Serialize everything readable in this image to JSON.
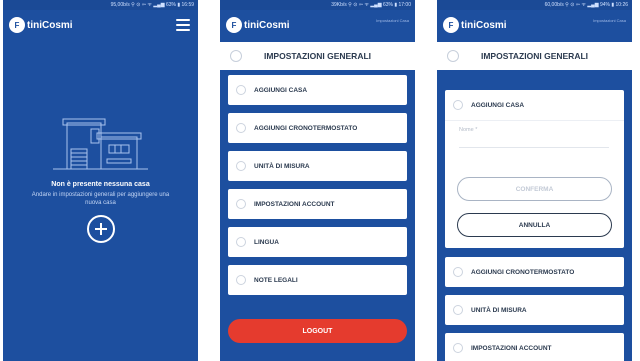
{
  "status_bars": {
    "phone1": "95,00b/s ⚲ ⊙ ⇦ ᯤ ▂▄▆ 63% ▮ 16:59",
    "phone2": "39Kb/s ⚲ ⊙ ⇦ ᯤ ▂▄▆ 63% ▮ 17:00",
    "phone3": "60,00b/s ⚲ ⊙ ⇦ ᯤ ▂▄▆ 94% ▮ 10:26"
  },
  "app": {
    "logo_mark": "F",
    "logo_text": "tiniCosmi",
    "subtitle": "Impostazioni Casa"
  },
  "phone1": {
    "empty_title": "Non è presente nessuna casa",
    "empty_subtitle": "Andare in impostazioni generali per aggiungere una nuova casa",
    "add_label": "+"
  },
  "settings": {
    "title": "IMPOSTAZIONI GENERALI",
    "items": [
      {
        "label": "AGGIUNGI CASA"
      },
      {
        "label": "AGGIUNGI CRONOTERMOSTATO"
      },
      {
        "label": "UNITÀ DI MISURA"
      },
      {
        "label": "IMPOSTAZIONI ACCOUNT"
      },
      {
        "label": "LINGUA"
      },
      {
        "label": "NOTE LEGALI"
      }
    ],
    "logout_label": "LOGOUT"
  },
  "phone3": {
    "expanded_label": "AGGIUNGI CASA",
    "name_placeholder": "Nome *",
    "confirm_label": "CONFERMA",
    "cancel_label": "ANNULLA",
    "items": [
      {
        "label": "AGGIUNGI CRONOTERMOSTATO"
      },
      {
        "label": "UNITÀ DI MISURA"
      },
      {
        "label": "IMPOSTAZIONI ACCOUNT"
      }
    ]
  },
  "colors": {
    "primary": "#1d4f9f",
    "logout": "#e53b2e"
  }
}
